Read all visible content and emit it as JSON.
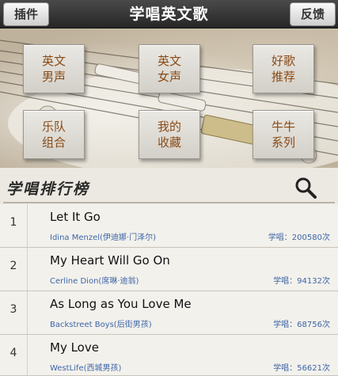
{
  "header": {
    "title": "学唱英文歌",
    "left_button": "插件",
    "right_button": "反馈"
  },
  "categories": [
    {
      "line1": "英文",
      "line2": "男声"
    },
    {
      "line1": "英文",
      "line2": "女声"
    },
    {
      "line1": "好歌",
      "line2": "推荐"
    },
    {
      "line1": "乐队",
      "line2": "组合"
    },
    {
      "line1": "我的",
      "line2": "收藏"
    },
    {
      "line1": "牛牛",
      "line2": "系列"
    }
  ],
  "ranking": {
    "title": "学唱排行榜",
    "items": [
      {
        "rank": "1",
        "song": "Let It Go",
        "artist": "Idina Menzel(伊迪娜·门泽尔)",
        "plays": "学唱：200580次"
      },
      {
        "rank": "2",
        "song": "My Heart Will Go On",
        "artist": "Cerline Dion(席琳·迪翁)",
        "plays": "学唱：94132次"
      },
      {
        "rank": "3",
        "song": "As Long as You Love Me",
        "artist": "Backstreet Boys(后街男孩)",
        "plays": "学唱：68756次"
      },
      {
        "rank": "4",
        "song": "My Love",
        "artist": "WestLife(西城男孩)",
        "plays": "学唱：56621次"
      }
    ]
  },
  "icons": {
    "search": "search-icon"
  }
}
